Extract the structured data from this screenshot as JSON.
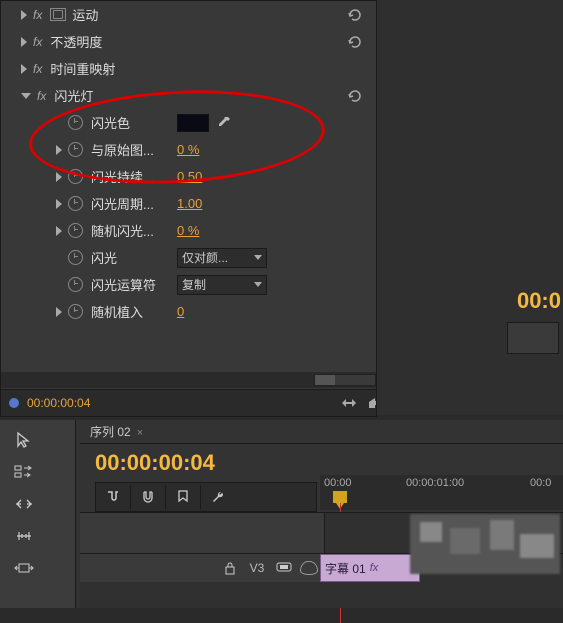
{
  "effects": {
    "items": [
      {
        "name": "运动",
        "type": "fx-header",
        "reset": true
      },
      {
        "name": "不透明度",
        "type": "fx-header",
        "reset": true
      },
      {
        "name": "时间重映射",
        "type": "fx-header",
        "reset": false
      },
      {
        "name": "闪光灯",
        "type": "fx-header-open",
        "reset": true
      }
    ],
    "strobe": {
      "props": [
        {
          "label": "闪光色",
          "kind": "color"
        },
        {
          "label": "与原始图...",
          "kind": "value",
          "value": "0 %",
          "expand": true
        },
        {
          "label": "闪光持续...",
          "kind": "value",
          "value": "0.50",
          "expand": true
        },
        {
          "label": "闪光周期...",
          "kind": "value",
          "value": "1.00",
          "expand": true
        },
        {
          "label": "随机闪光...",
          "kind": "value",
          "value": "0 %",
          "expand": true
        },
        {
          "label": "闪光",
          "kind": "dropdown",
          "value": "仅对颜..."
        },
        {
          "label": "闪光运算符",
          "kind": "dropdown",
          "value": "复制"
        },
        {
          "label": "随机植入",
          "kind": "value",
          "value": "0",
          "expand": true
        }
      ]
    }
  },
  "timecode_small": "00:00:00:04",
  "right_tc": "00:0",
  "sequence": {
    "tab": "序列 02",
    "close": "×"
  },
  "timeline": {
    "tc": "00:00:00:04",
    "ruler": [
      "00:00",
      "00:00:01:00",
      "00:0"
    ],
    "track": {
      "lock": "",
      "label": "V3"
    },
    "clip": {
      "title": "字幕 01",
      "fx": "fx"
    }
  }
}
